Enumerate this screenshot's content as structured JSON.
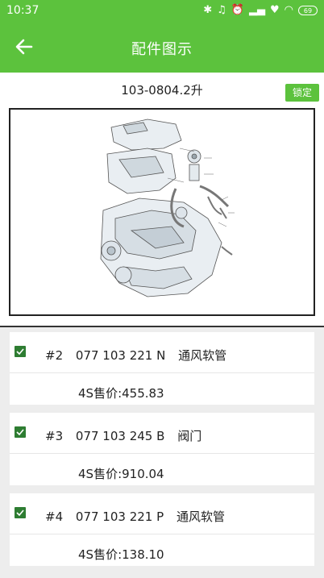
{
  "status_bar": {
    "time": "10:37",
    "icons": [
      "bluetooth-icon",
      "mute-icon",
      "alarm-icon",
      "signal-icon",
      "heart-icon",
      "wifi-icon"
    ],
    "battery": "69"
  },
  "app_bar": {
    "back_icon": "arrow-left-icon",
    "title": "配件图示"
  },
  "header": {
    "model": "103-0804.2升",
    "lock_label": "锁定"
  },
  "parts": [
    {
      "checked": true,
      "index": "#2",
      "part_no": "077 103 221 N",
      "name": "通风软管",
      "price": "4S售价:455.83"
    },
    {
      "checked": true,
      "index": "#3",
      "part_no": "077 103 245 B",
      "name": "阀门",
      "price": "4S售价:910.04"
    },
    {
      "checked": true,
      "index": "#4",
      "part_no": "077 103 221 P",
      "name": "通风软管",
      "price": "4S售价:138.10"
    }
  ],
  "colors": {
    "primary": "#5cc23d",
    "checkbox": "#2e7d32",
    "list_bg": "#ededed"
  }
}
